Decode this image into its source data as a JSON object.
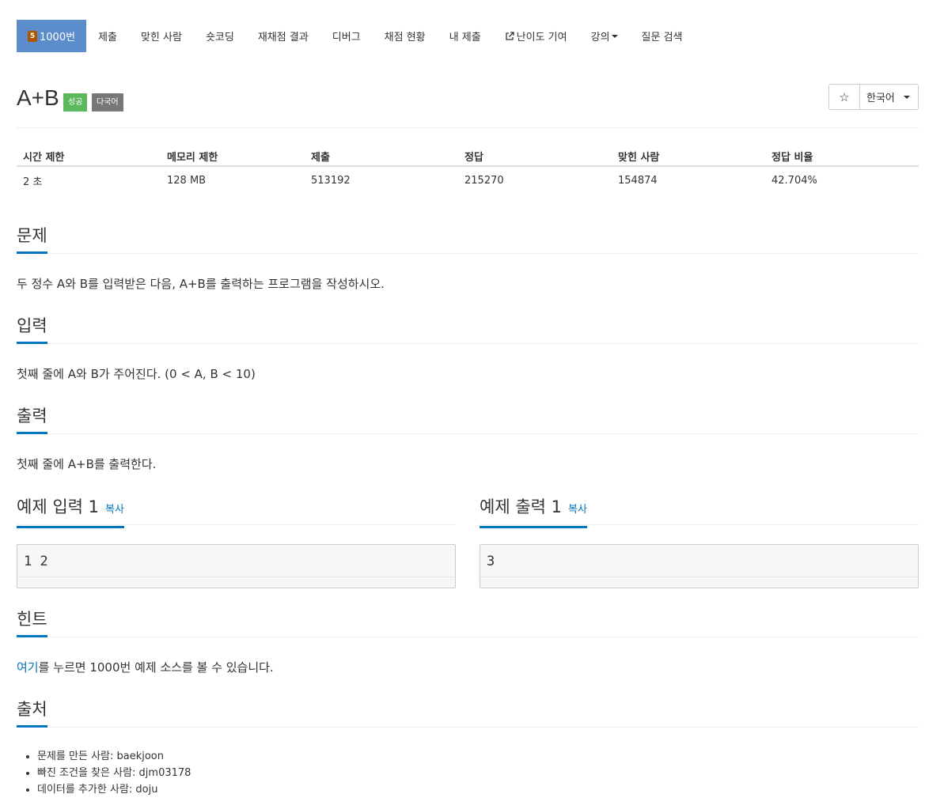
{
  "nav": {
    "tier_badge": "5",
    "active_label": "1000번",
    "items": [
      {
        "label": "제출"
      },
      {
        "label": "맞힌 사람"
      },
      {
        "label": "숏코딩"
      },
      {
        "label": "재채점 결과"
      },
      {
        "label": "디버그"
      },
      {
        "label": "채점 현황"
      },
      {
        "label": "내 제출"
      },
      {
        "label": "난이도 기여"
      },
      {
        "label": "강의"
      },
      {
        "label": "질문 검색"
      }
    ]
  },
  "problem": {
    "title": "A+B",
    "badge_success": "성공",
    "badge_lang": "다국어",
    "star_glyph": "☆",
    "language": "한국어"
  },
  "info": {
    "headers": [
      "시간 제한",
      "메모리 제한",
      "제출",
      "정답",
      "맞힌 사람",
      "정답 비율"
    ],
    "values": [
      "2 초",
      "128 MB",
      "513192",
      "215270",
      "154874",
      "42.704%"
    ]
  },
  "sections": {
    "problem_title": "문제",
    "problem_text": "두 정수 A와 B를 입력받은 다음, A+B를 출력하는 프로그램을 작성하시오.",
    "input_title": "입력",
    "input_text": "첫째 줄에 A와 B가 주어진다. (0 < A, B < 10)",
    "output_title": "출력",
    "output_text": "첫째 줄에 A+B를 출력한다.",
    "sample_input_title": "예제 입력 1",
    "sample_output_title": "예제 출력 1",
    "copy_label": "복사",
    "sample_input": "1 2",
    "sample_output": "3",
    "hint_title": "힌트",
    "hint_link": "여기",
    "hint_text": "를 누르면 1000번 예제 소스를 볼 수 있습니다.",
    "source_title": "출처",
    "source_items": [
      "문제를 만든 사람: baekjoon",
      "빠진 조건을 찾은 사람: djm03178",
      "데이터를 추가한 사람: doju"
    ]
  }
}
